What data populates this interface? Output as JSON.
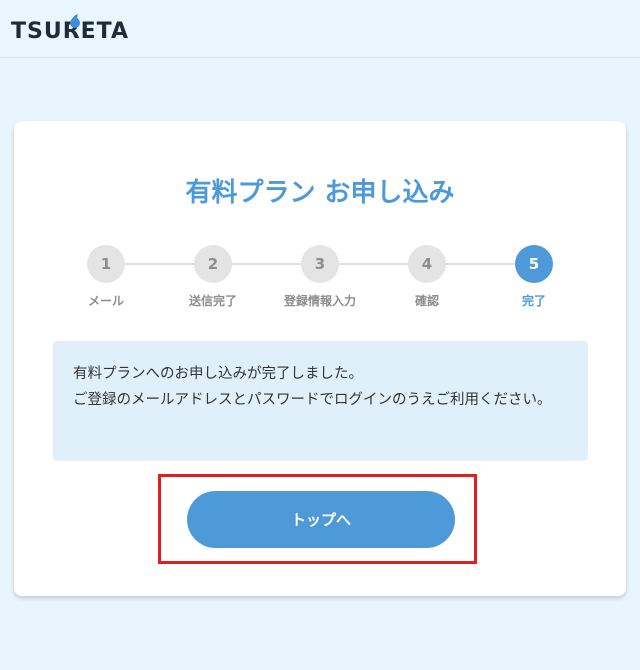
{
  "header": {
    "logo_text": "TSURETA"
  },
  "card": {
    "title": "有料プラン お申し込み",
    "steps": [
      {
        "number": "1",
        "label": "メール",
        "active": false
      },
      {
        "number": "2",
        "label": "送信完了",
        "active": false
      },
      {
        "number": "3",
        "label": "登録情報入力",
        "active": false
      },
      {
        "number": "4",
        "label": "確認",
        "active": false
      },
      {
        "number": "5",
        "label": "完了",
        "active": true
      }
    ],
    "message": {
      "line1": "有料プランへのお申し込みが完了しました。",
      "line2": "ご登録のメールアドレスとパスワードでログインのうえご利用ください。"
    },
    "button_label": "トップへ"
  },
  "colors": {
    "accent": "#4e9ad9",
    "highlight_border": "#e02020",
    "message_bg": "#dff0fb",
    "page_bg": "#e8f5fd"
  }
}
